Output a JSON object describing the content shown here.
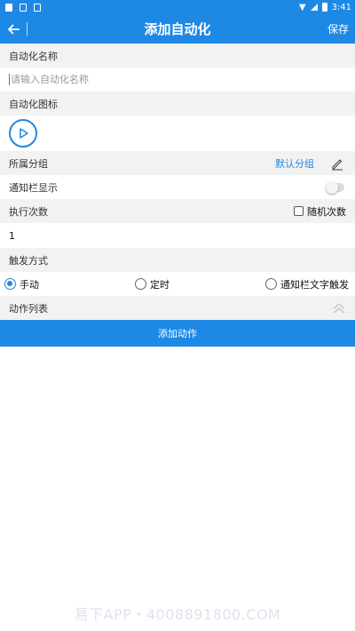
{
  "status_bar": {
    "time": "3:41"
  },
  "toolbar": {
    "back_icon": "arrow-left-icon",
    "title": "添加自动化",
    "save_label": "保存"
  },
  "form": {
    "name_label": "自动化名称",
    "name_placeholder": "请输入自动化名称",
    "name_value": "",
    "icon_label": "自动化图标",
    "icon_name": "play-icon",
    "group_label": "所属分组",
    "group_value": "默认分组",
    "notification_label": "通知栏显示",
    "notification_enabled": false,
    "exec_count_label": "执行次数",
    "random_count_label": "随机次数",
    "random_count_checked": false,
    "exec_count_value": "1",
    "trigger_label": "触发方式",
    "trigger_options": [
      {
        "label": "手动",
        "checked": true
      },
      {
        "label": "定时",
        "checked": false
      },
      {
        "label": "通知栏文字触发",
        "checked": false
      }
    ],
    "actions_label": "动作列表",
    "add_action_label": "添加动作"
  },
  "watermark": "易下APP・4008891800.COM",
  "colors": {
    "primary": "#1e88e5",
    "section_bg": "#f2f2f2"
  }
}
